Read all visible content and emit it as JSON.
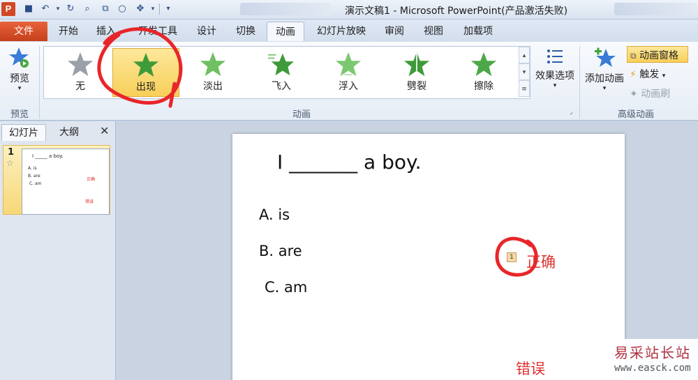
{
  "window": {
    "title": "演示文稿1 - Microsoft PowerPoint(产品激活失败)",
    "app_icon": "P"
  },
  "tabs": {
    "file": "文件",
    "items": [
      "开始",
      "插入",
      "开发工具",
      "设计",
      "切换",
      "动画",
      "幻灯片放映",
      "审阅",
      "视图",
      "加载项"
    ],
    "active": "动画"
  },
  "ribbon": {
    "preview": {
      "label": "预览",
      "group": "预览"
    },
    "gallery": {
      "group": "动画",
      "items": [
        {
          "label": "无",
          "icon": "star-none-icon",
          "color": "#9aa0a8"
        },
        {
          "label": "出现",
          "icon": "star-appear-icon",
          "color": "#3f9a3a",
          "selected": true
        },
        {
          "label": "淡出",
          "icon": "star-fade-icon",
          "color": "#6ec060"
        },
        {
          "label": "飞入",
          "icon": "star-flyin-icon",
          "color": "#3f9a3a"
        },
        {
          "label": "浮入",
          "icon": "star-floatin-icon",
          "color": "#7cc870"
        },
        {
          "label": "劈裂",
          "icon": "star-split-icon",
          "color": "#3f9a3a"
        },
        {
          "label": "擦除",
          "icon": "star-wipe-icon",
          "color": "#4da848"
        }
      ]
    },
    "effect_options": "效果选项",
    "add_animation": "添加动画",
    "animation_pane": "动画窗格",
    "trigger": "触发",
    "animation_painter": "动画刷",
    "advanced_group": "高级动画"
  },
  "left_pane": {
    "tabs": [
      "幻灯片",
      "大纲"
    ],
    "close": "✕",
    "slide_number": "1",
    "thumb": {
      "title": "I _____ a boy.",
      "a": "A. is",
      "b": "B. are",
      "c": "C. am",
      "correct": "正确",
      "wrong": "错误"
    }
  },
  "slide": {
    "title": "I  _______  a boy.",
    "options": [
      "A.  is",
      "B.  are",
      "C.  am"
    ],
    "anim_marker": "1",
    "correct_label": "正确",
    "wrong_label": "错误"
  },
  "watermark": {
    "title": "易采站长站",
    "url": "www.easck.com"
  },
  "colors": {
    "accent_red": "#e03030",
    "file_tab": "#d24726",
    "selection": "#f8cf5a"
  }
}
